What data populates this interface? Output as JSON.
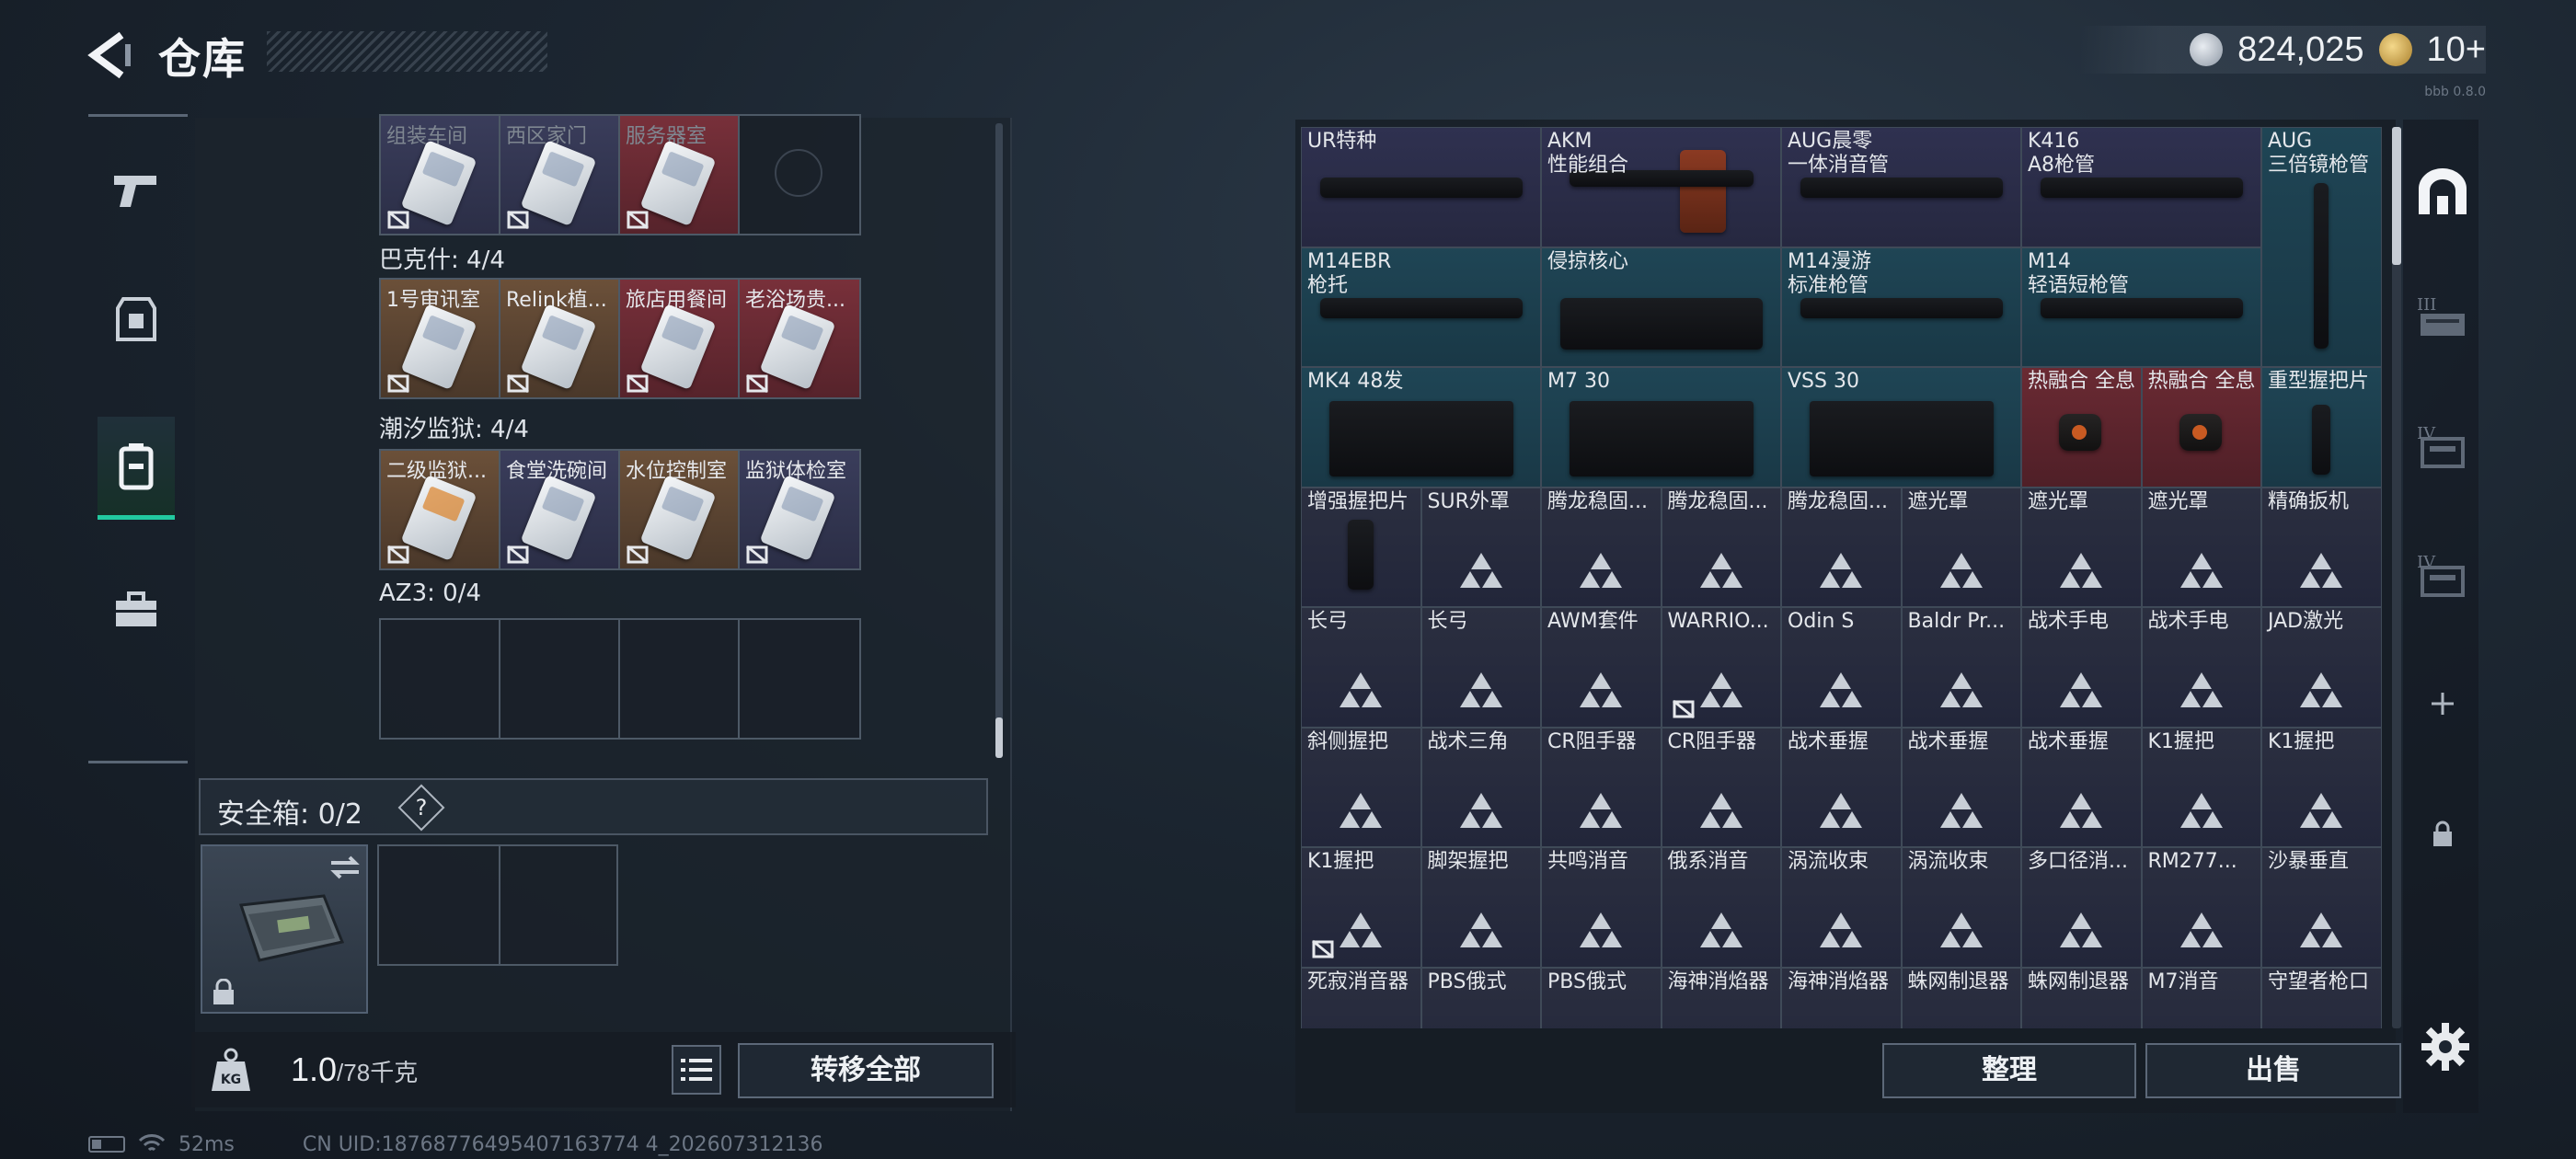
{
  "header": {
    "title": "仓库",
    "currency_silver": "824,025",
    "currency_gold": "10+",
    "version": "bbb 0.8.0"
  },
  "left": {
    "groups": [
      {
        "label": "",
        "cards": [
          {
            "name": "组装车间",
            "color": "purple",
            "dim": true
          },
          {
            "name": "西区家门",
            "color": "purple",
            "dim": true
          },
          {
            "name": "服务器室",
            "color": "red",
            "dim": true
          },
          {
            "name": "",
            "color": "empty",
            "dim": false
          }
        ]
      },
      {
        "label": "巴克什: 4/4",
        "cards": [
          {
            "name": "1号审讯室",
            "color": "gold"
          },
          {
            "name": "Relink植...",
            "color": "gold"
          },
          {
            "name": "旅店用餐间",
            "color": "red"
          },
          {
            "name": "老浴场贵...",
            "color": "red"
          }
        ]
      },
      {
        "label": "潮汐监狱: 4/4",
        "cards": [
          {
            "name": "二级监狱...",
            "color": "gold",
            "orange": true
          },
          {
            "name": "食堂洗碗间",
            "color": "purple"
          },
          {
            "name": "水位控制室",
            "color": "gold"
          },
          {
            "name": "监狱体检室",
            "color": "purple"
          }
        ]
      },
      {
        "label": "AZ3: 0/4",
        "cards": [
          {
            "name": "",
            "color": "empty"
          },
          {
            "name": "",
            "color": "empty"
          },
          {
            "name": "",
            "color": "empty"
          },
          {
            "name": "",
            "color": "empty"
          }
        ]
      }
    ],
    "safe_box": {
      "label": "安全箱: 0/2",
      "help": "?"
    },
    "weight": {
      "current": "1.0",
      "max": "/78千克"
    },
    "transfer_all": "转移全部",
    "kg_label": "KG"
  },
  "status": {
    "ping": "52ms",
    "uid": "CN UID:18768776495407163774 4_202607312136"
  },
  "right": {
    "sort_label": "整理",
    "sell_label": "出售",
    "rows": [
      [
        {
          "name": "UR特种",
          "color": "purple"
        },
        {
          "name": "AKM\n性能组合",
          "color": "purple",
          "wood": true
        },
        {
          "name": "AUG晨零\n一体消音管",
          "color": "purple"
        },
        {
          "name": "K416\nA8枪管",
          "color": "purple"
        },
        {
          "name": "AUG\n三倍镜枪管",
          "color": "teal"
        }
      ],
      [
        {
          "name": "M14EBR\n枪托",
          "color": "teal"
        },
        {
          "name": "侵掠核心",
          "color": "teal"
        },
        {
          "name": "M14漫游\n标准枪管",
          "color": "teal"
        },
        {
          "name": "M14\n轻语短枪管",
          "color": "teal"
        }
      ],
      [
        {
          "name": "MK4 48发",
          "color": "teal"
        },
        {
          "name": "M7 30",
          "color": "teal"
        },
        {
          "name": "VSS 30",
          "color": "teal"
        },
        {
          "name": "热融合 全息",
          "color": "red"
        },
        {
          "name": "热融合 全息",
          "color": "red"
        },
        {
          "name": "重型握把片",
          "color": "teal"
        }
      ],
      [
        {
          "name": "增强握把片",
          "color": "dark",
          "part": true
        },
        {
          "name": "SUR外罩",
          "color": "dark"
        },
        {
          "name": "腾龙稳固...",
          "color": "dark"
        },
        {
          "name": "腾龙稳固...",
          "color": "dark"
        },
        {
          "name": "腾龙稳固...",
          "color": "dark"
        },
        {
          "name": "遮光罩",
          "color": "dark"
        },
        {
          "name": "遮光罩",
          "color": "dark"
        },
        {
          "name": "遮光罩",
          "color": "dark"
        },
        {
          "name": "精确扳机",
          "color": "dark"
        }
      ],
      [
        {
          "name": "长弓",
          "color": "dark"
        },
        {
          "name": "长弓",
          "color": "dark"
        },
        {
          "name": "AWM套件",
          "color": "dark"
        },
        {
          "name": "WARRIO...",
          "color": "dark",
          "nodur": true
        },
        {
          "name": "Odin S",
          "color": "dark"
        },
        {
          "name": "Baldr Pr...",
          "color": "dark"
        },
        {
          "name": "战术手电",
          "color": "dark"
        },
        {
          "name": "战术手电",
          "color": "dark"
        },
        {
          "name": "JAD激光",
          "color": "dark"
        }
      ],
      [
        {
          "name": "斜侧握把",
          "color": "dark"
        },
        {
          "name": "战术三角",
          "color": "dark"
        },
        {
          "name": "CR阻手器",
          "color": "dark"
        },
        {
          "name": "CR阻手器",
          "color": "dark"
        },
        {
          "name": "战术垂握",
          "color": "dark"
        },
        {
          "name": "战术垂握",
          "color": "dark"
        },
        {
          "name": "战术垂握",
          "color": "dark"
        },
        {
          "name": "K1握把",
          "color": "dark"
        },
        {
          "name": "K1握把",
          "color": "dark"
        }
      ],
      [
        {
          "name": "K1握把",
          "color": "dark",
          "nodur": true
        },
        {
          "name": "脚架握把",
          "color": "dark"
        },
        {
          "name": "共鸣消音",
          "color": "dark"
        },
        {
          "name": "俄系消音",
          "color": "dark"
        },
        {
          "name": "涡流收束",
          "color": "dark"
        },
        {
          "name": "涡流收束",
          "color": "dark"
        },
        {
          "name": "多口径消...",
          "color": "dark"
        },
        {
          "name": "RM277...",
          "color": "dark"
        },
        {
          "name": "沙暴垂直",
          "color": "dark"
        }
      ],
      [
        {
          "name": "死寂消音器",
          "color": "dark"
        },
        {
          "name": "PBS俄式",
          "color": "dark"
        },
        {
          "name": "PBS俄式",
          "color": "dark"
        },
        {
          "name": "海神消焰器",
          "color": "dark"
        },
        {
          "name": "海神消焰器",
          "color": "dark"
        },
        {
          "name": "蛛网制退器",
          "color": "dark"
        },
        {
          "name": "蛛网制退器",
          "color": "dark"
        },
        {
          "name": "M7消音",
          "color": "dark"
        },
        {
          "name": "守望者枪口",
          "color": "dark"
        }
      ]
    ]
  },
  "icons": {
    "back": "back-arrow-icon",
    "pistol": "pistol-icon",
    "armor": "armor-icon",
    "backpack": "backpack-icon",
    "case": "case-icon",
    "vault": "vault-icon",
    "plus": "plus-icon",
    "lock": "lock-icon",
    "gear": "gear-icon",
    "list": "list-icon"
  },
  "colors": {
    "accent": "#22c9a0"
  }
}
